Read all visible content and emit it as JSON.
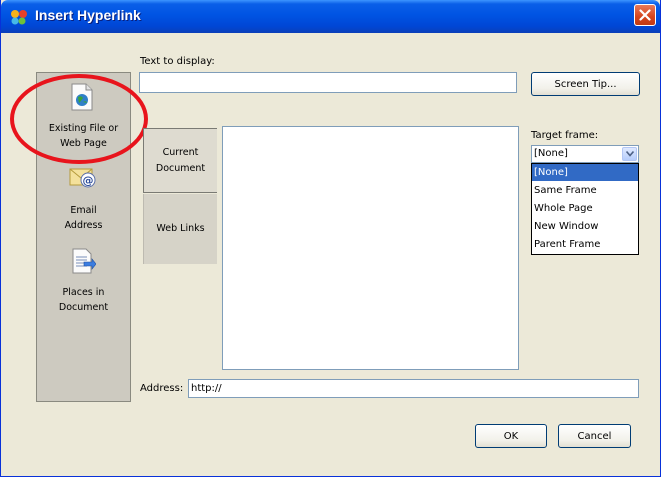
{
  "window": {
    "title": "Insert Hyperlink"
  },
  "text_to_display": {
    "label": "Text to display:",
    "value": ""
  },
  "screen_tip_button": "Screen Tip...",
  "sidebar": {
    "items": [
      {
        "label_line1": "Existing File or",
        "label_line2": "Web Page",
        "icon": "web-page-icon"
      },
      {
        "label_line1": "Email",
        "label_line2": "Address",
        "icon": "email-icon"
      },
      {
        "label_line1": "Places in",
        "label_line2": "Document",
        "icon": "document-icon"
      }
    ]
  },
  "tabs": [
    {
      "line1": "Current",
      "line2": "Document",
      "active": true
    },
    {
      "line1": "Web Links",
      "active": false
    }
  ],
  "target_frame": {
    "label": "Target frame:",
    "selected": "[None]",
    "options": [
      "[None]",
      "Same Frame",
      "Whole Page",
      "New Window",
      "Parent Frame"
    ]
  },
  "address": {
    "label": "Address:",
    "value": "http://"
  },
  "buttons": {
    "ok": "OK",
    "cancel": "Cancel"
  },
  "colors": {
    "title_bar": "#0054e3",
    "highlight": "#e8141c",
    "selection": "#316ac5",
    "window_bg": "#ece9d8"
  }
}
